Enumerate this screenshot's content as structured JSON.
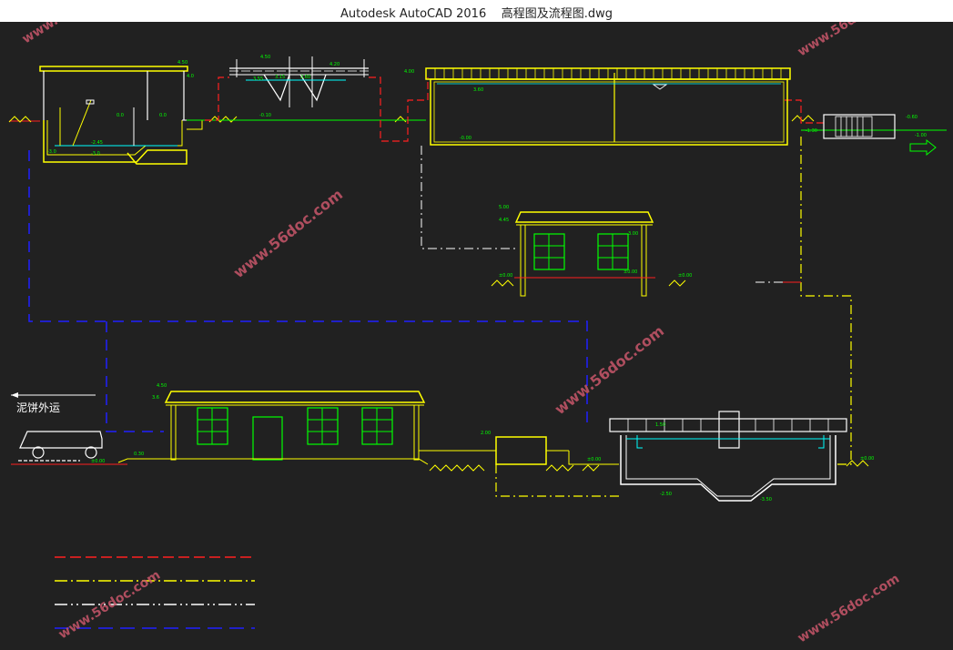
{
  "window": {
    "app": "Autodesk AutoCAD 2016",
    "file": "高程图及流程图.dwg"
  },
  "drawing": {
    "sludge_label": "泥饼外运",
    "watermark": "www.56doc.com",
    "colors": {
      "background": "#212121",
      "yellow": "#ffff00",
      "green": "#00ff00",
      "red": "#ff2020",
      "white": "#ffffff",
      "blue": "#2020ff",
      "cyan": "#00ffff",
      "watermark": "#c8566a"
    }
  }
}
